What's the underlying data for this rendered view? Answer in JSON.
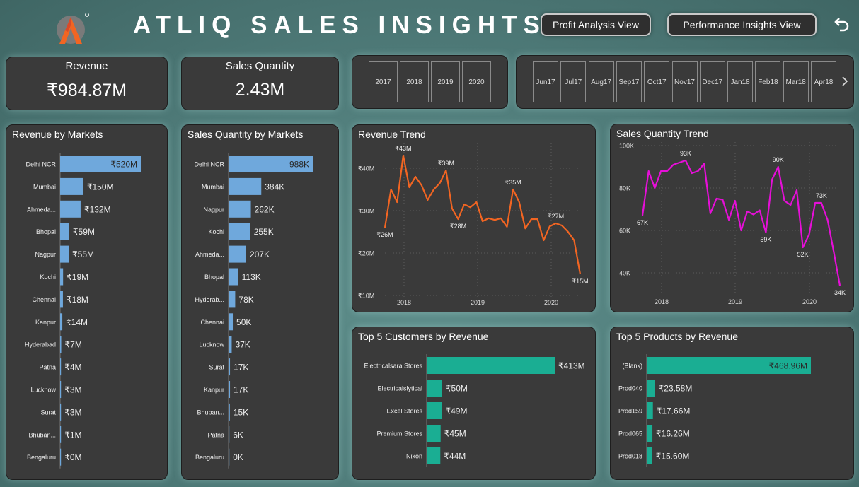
{
  "header": {
    "title": "ATLIQ SALES INSIGHTS",
    "profit_btn": "Profit Analysis View",
    "performance_btn": "Performance Insights View",
    "back_icon": "back-arrow-icon"
  },
  "kpis": {
    "revenue_label": "Revenue",
    "revenue_value": "₹984.87M",
    "quantity_label": "Sales Quantity",
    "quantity_value": "2.43M"
  },
  "year_slicer": [
    "2017",
    "2018",
    "2019",
    "2020"
  ],
  "month_slicer": [
    {
      "m": "Jun",
      "y": "17"
    },
    {
      "m": "Jul",
      "y": "17"
    },
    {
      "m": "Aug",
      "y": "17"
    },
    {
      "m": "Sep",
      "y": "17"
    },
    {
      "m": "Oct",
      "y": "17"
    },
    {
      "m": "Nov",
      "y": "17"
    },
    {
      "m": "Dec",
      "y": "17"
    },
    {
      "m": "Jan",
      "y": "18"
    },
    {
      "m": "Feb",
      "y": "18"
    },
    {
      "m": "Mar",
      "y": "18"
    },
    {
      "m": "Apr",
      "y": "18"
    }
  ],
  "chart_data": [
    {
      "id": "revenue_by_markets",
      "type": "bar",
      "orientation": "horizontal",
      "title": "Revenue by Markets",
      "color": "#6fa8dc",
      "categories": [
        "Delhi NCR",
        "Mumbai",
        "Ahmeda...",
        "Bhopal",
        "Nagpur",
        "Kochi",
        "Chennai",
        "Kanpur",
        "Hyderabad",
        "Patna",
        "Lucknow",
        "Surat",
        "Bhuban...",
        "Bengaluru"
      ],
      "values": [
        520,
        150,
        132,
        59,
        55,
        19,
        18,
        14,
        7,
        4,
        3,
        3,
        1,
        0
      ],
      "labels": [
        "₹520M",
        "₹150M",
        "₹132M",
        "₹59M",
        "₹55M",
        "₹19M",
        "₹18M",
        "₹14M",
        "₹7M",
        "₹4M",
        "₹3M",
        "₹3M",
        "₹1M",
        "₹0M"
      ],
      "unit": "₹M"
    },
    {
      "id": "quantity_by_markets",
      "type": "bar",
      "orientation": "horizontal",
      "title": "Sales Quantity by Markets",
      "color": "#6fa8dc",
      "categories": [
        "Delhi NCR",
        "Mumbai",
        "Nagpur",
        "Kochi",
        "Ahmeda...",
        "Bhopal",
        "Hyderab...",
        "Chennai",
        "Lucknow",
        "Surat",
        "Kanpur",
        "Bhuban...",
        "Patna",
        "Bengaluru"
      ],
      "values": [
        988,
        384,
        262,
        255,
        207,
        113,
        78,
        50,
        37,
        17,
        17,
        15,
        6,
        0
      ],
      "labels": [
        "988K",
        "384K",
        "262K",
        "255K",
        "207K",
        "113K",
        "78K",
        "50K",
        "37K",
        "17K",
        "17K",
        "15K",
        "6K",
        "0K"
      ],
      "unit": "K"
    },
    {
      "id": "revenue_trend",
      "type": "line",
      "title": "Revenue Trend",
      "color": "#f26522",
      "x_ticks": [
        "2018",
        "2019",
        "2020"
      ],
      "y_ticks": [
        "₹10M",
        "₹20M",
        "₹30M",
        "₹40M"
      ],
      "ylim": [
        10,
        45
      ],
      "values": [
        26,
        35,
        32,
        43,
        35.5,
        38,
        36,
        32.5,
        35,
        36.5,
        39.5,
        30.5,
        28,
        31.5,
        30.8,
        32,
        27.5,
        28.2,
        27.8,
        28.2,
        26.2,
        35,
        32,
        25.8,
        28,
        28,
        23,
        26.3,
        27,
        26.5,
        25,
        23,
        15
      ],
      "point_labels": [
        {
          "i": 0,
          "text": "₹26M",
          "pos": "below"
        },
        {
          "i": 3,
          "text": "₹43M",
          "pos": "above"
        },
        {
          "i": 10,
          "text": "₹39M",
          "pos": "above"
        },
        {
          "i": 12,
          "text": "₹28M",
          "pos": "below"
        },
        {
          "i": 21,
          "text": "₹35M",
          "pos": "above"
        },
        {
          "i": 28,
          "text": "₹27M",
          "pos": "above"
        },
        {
          "i": 32,
          "text": "₹15M",
          "pos": "below"
        }
      ]
    },
    {
      "id": "quantity_trend",
      "type": "line",
      "title": "Sales Quantity Trend",
      "color": "#e60fd8",
      "x_ticks": [
        "2018",
        "2019",
        "2020"
      ],
      "y_ticks": [
        "40K",
        "60K",
        "80K",
        "100K"
      ],
      "ylim": [
        30,
        100
      ],
      "values": [
        67,
        88,
        80,
        88,
        88,
        91,
        92,
        93,
        87,
        88,
        91.5,
        68,
        75,
        74.5,
        65,
        74,
        60,
        69,
        67.5,
        69.5,
        59,
        84,
        90,
        74,
        72,
        79,
        52,
        58,
        73,
        73,
        65,
        50,
        34
      ],
      "point_labels": [
        {
          "i": 0,
          "text": "67K",
          "pos": "below"
        },
        {
          "i": 7,
          "text": "93K",
          "pos": "above"
        },
        {
          "i": 20,
          "text": "59K",
          "pos": "below"
        },
        {
          "i": 22,
          "text": "90K",
          "pos": "above"
        },
        {
          "i": 26,
          "text": "52K",
          "pos": "below"
        },
        {
          "i": 29,
          "text": "73K",
          "pos": "above"
        },
        {
          "i": 32,
          "text": "34K",
          "pos": "below"
        }
      ]
    },
    {
      "id": "top_customers",
      "type": "bar",
      "orientation": "horizontal",
      "title": "Top 5 Customers by Revenue",
      "color": "#1aae93",
      "categories": [
        "Electricalsara Stores",
        "Electricalslytical",
        "Excel Stores",
        "Premium Stores",
        "Nixon"
      ],
      "values": [
        413,
        50,
        49,
        45,
        44
      ],
      "labels": [
        "₹413M",
        "₹50M",
        "₹49M",
        "₹45M",
        "₹44M"
      ],
      "unit": "₹M"
    },
    {
      "id": "top_products",
      "type": "bar",
      "orientation": "horizontal",
      "title": "Top 5 Products by Revenue",
      "color": "#1aae93",
      "categories": [
        "(Blank)",
        "Prod040",
        "Prod159",
        "Prod065",
        "Prod018"
      ],
      "values": [
        468.96,
        23.58,
        17.66,
        16.26,
        15.6
      ],
      "labels": [
        "₹468.96M",
        "₹23.58M",
        "₹17.66M",
        "₹16.26M",
        "₹15.60M"
      ],
      "unit": "₹M"
    }
  ]
}
